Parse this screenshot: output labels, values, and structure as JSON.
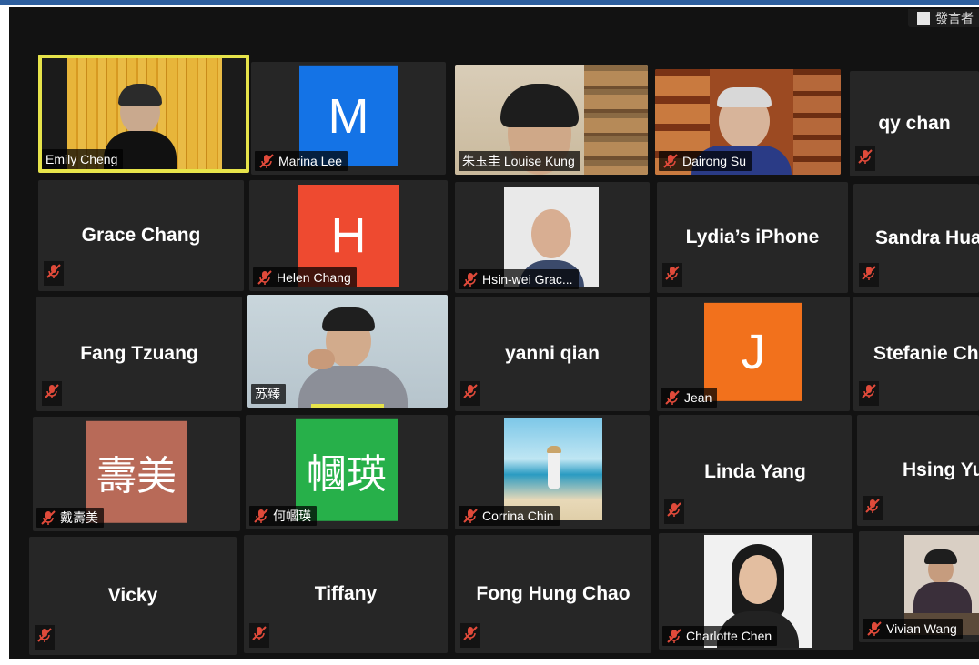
{
  "corner_label": "發言者",
  "colors": {
    "active_border": "#e6e34a",
    "tile_bg": "#262626",
    "mute": "#e04a3a"
  },
  "participants": [
    {
      "name": "Emily Cheng",
      "muted": false,
      "type": "video",
      "active": true
    },
    {
      "name": "Marina Lee",
      "muted": true,
      "type": "letter",
      "letter": "M",
      "avatar_color": "#1473e6"
    },
    {
      "name": "朱玉圭 Louise Kung",
      "muted": false,
      "type": "video"
    },
    {
      "name": "Dairong Su",
      "muted": true,
      "type": "video"
    },
    {
      "name": "qy chan",
      "muted": true,
      "type": "name"
    },
    {
      "name": "Grace Chang",
      "muted": true,
      "type": "name"
    },
    {
      "name": "Helen Chang",
      "muted": true,
      "type": "letter",
      "letter": "H",
      "avatar_color": "#ee4a30"
    },
    {
      "name": "Hsin-wei Grac...",
      "muted": true,
      "type": "photo"
    },
    {
      "name": "Lydia’s iPhone",
      "muted": true,
      "type": "name"
    },
    {
      "name": "Sandra Hua",
      "muted": true,
      "type": "name"
    },
    {
      "name": "Fang Tzuang",
      "muted": true,
      "type": "name"
    },
    {
      "name": "苏臻",
      "muted": false,
      "type": "video"
    },
    {
      "name": "yanni qian",
      "muted": true,
      "type": "name"
    },
    {
      "name": "Jean",
      "muted": true,
      "type": "letter",
      "letter": "J",
      "avatar_color": "#f2711c"
    },
    {
      "name": "Stefanie Ch",
      "muted": true,
      "type": "name"
    },
    {
      "name": "戴壽美",
      "muted": true,
      "type": "letter",
      "letter": "壽美",
      "avatar_color": "#b86a58"
    },
    {
      "name": "何幗瑛",
      "muted": true,
      "type": "letter",
      "letter": "幗瑛",
      "avatar_color": "#27b04a"
    },
    {
      "name": "Corrina Chin",
      "muted": true,
      "type": "photo"
    },
    {
      "name": "Linda Yang",
      "muted": true,
      "type": "name"
    },
    {
      "name": "Hsing Yu",
      "muted": true,
      "type": "name"
    },
    {
      "name": "Vicky",
      "muted": true,
      "type": "name"
    },
    {
      "name": "Tiffany",
      "muted": true,
      "type": "name"
    },
    {
      "name": "Fong Hung Chao",
      "muted": true,
      "type": "name"
    },
    {
      "name": "Charlotte Chen",
      "muted": true,
      "type": "photo"
    },
    {
      "name": "Vivian Wang",
      "muted": true,
      "type": "photo"
    }
  ]
}
